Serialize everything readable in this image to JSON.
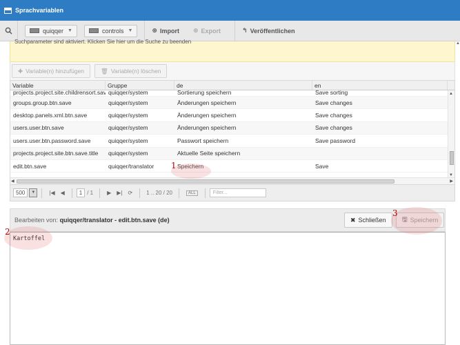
{
  "window": {
    "title": "Sprachvariablen"
  },
  "toolbar": {
    "select_project": "quiqqer",
    "select_group": "controls",
    "import_label": "Import",
    "export_label": "Export",
    "publish_label": "Veröffentlichen"
  },
  "notice": "Suchparameter sind aktiviert. Klicken Sie hier um die Suche zu beenden",
  "panel_toolbar": {
    "add_label": "Variable(n) hinzufügen",
    "delete_label": "Variable(n) löschen"
  },
  "grid": {
    "columns": [
      "Variable",
      "Gruppe",
      "de",
      "en"
    ],
    "rows": [
      [
        "projects.project.site.childrensort.save",
        "quiqqer/system",
        "Sortierung speichern",
        "Save sorting"
      ],
      [
        "groups.group.btn.save",
        "quiqqer/system",
        "Änderungen speichern",
        "Save changes"
      ],
      [
        "desktop.panels.xml.btn.save",
        "quiqqer/system",
        "Änderungen speichern",
        "Save changes"
      ],
      [
        "users.user.btn.save",
        "quiqqer/system",
        "Änderungen speichern",
        "Save changes"
      ],
      [
        "users.user.btn.password.save",
        "quiqqer/system",
        "Passwort speichern",
        "Save password"
      ],
      [
        "projects.project.site.btn.save.title",
        "quiqqer/system",
        "Aktuelle Seite speichern",
        ""
      ],
      [
        "edit.btn.save",
        "quiqqer/translator",
        "Speichern",
        "Save"
      ]
    ]
  },
  "pager": {
    "per_page": "500",
    "page": "1",
    "page_total": "/ 1",
    "range": "1 .. 20 / 20",
    "filter_placeholder": "Filter..."
  },
  "edit": {
    "prefix": "Bearbeiten von:",
    "target": "quiqqer/translator - edit.btn.save (de)",
    "close_label": "Schließen",
    "save_label": "Speichern",
    "content": "Kartoffel"
  },
  "markers": {
    "m1": "1",
    "m2": "2",
    "m3": "3"
  },
  "colors": {
    "titlebar": "#2d7cc4",
    "notice": "#fdf6cf",
    "marker": "#b40000"
  }
}
